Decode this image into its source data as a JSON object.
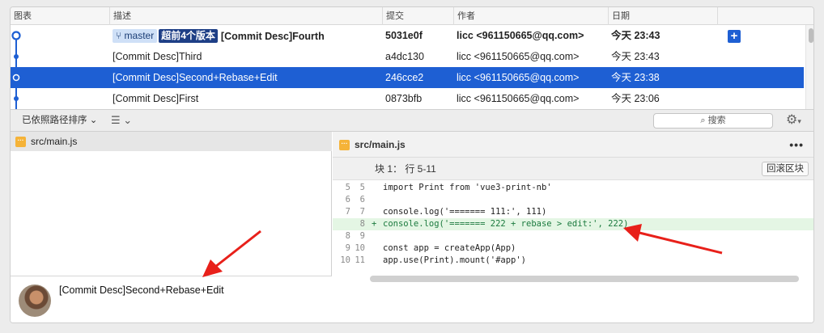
{
  "header": {
    "columns": [
      "图表",
      "描述",
      "提交",
      "作者",
      "日期"
    ]
  },
  "commits": [
    {
      "branch": "master",
      "ahead": "超前4个版本",
      "message": "[Commit Desc]Fourth",
      "hash": "5031e0f",
      "author": "licc <961150665@qq.com>",
      "date": "今天 23:43",
      "action": "+"
    },
    {
      "message": "[Commit Desc]Third",
      "hash": "a4dc130",
      "author": "licc <961150665@qq.com>",
      "date": "今天 23:43"
    },
    {
      "message": "[Commit Desc]Second+Rebase+Edit",
      "hash": "246cce2",
      "author": "licc <961150665@qq.com>",
      "date": "今天 23:38"
    },
    {
      "message": "[Commit Desc]First",
      "hash": "0873bfb",
      "author": "licc <961150665@qq.com>",
      "date": "今天 23:06"
    }
  ],
  "toolbar": {
    "sort_label": "已依照路径排序 ⌄",
    "list_label": "☰ ⌄",
    "search_placeholder": "搜索",
    "search_icon": "magnifier-icon",
    "settings_icon": "gear-icon"
  },
  "files": {
    "icon_text": "···",
    "selected": "src/main.js"
  },
  "commit_detail": {
    "message": "[Commit Desc]Second+Rebase+Edit"
  },
  "diff": {
    "filename": "src/main.js",
    "more_label": "•••",
    "hunk_title": "块 1： 行 5-11",
    "discard_label": "回滚区块",
    "lines": [
      {
        "old": "5",
        "new": "5",
        "sign": "",
        "code": "import Print from 'vue3-print-nb'",
        "type": "context"
      },
      {
        "old": "6",
        "new": "6",
        "sign": "",
        "code": "",
        "type": "context"
      },
      {
        "old": "7",
        "new": "7",
        "sign": "",
        "code": "console.log('======= 111:', 111)",
        "type": "context"
      },
      {
        "old": "",
        "new": "8",
        "sign": "+",
        "code": "console.log('======= 222 + rebase > edit:', 222)",
        "type": "add"
      },
      {
        "old": "8",
        "new": "9",
        "sign": "",
        "code": "",
        "type": "context"
      },
      {
        "old": "9",
        "new": "10",
        "sign": "",
        "code": "const app = createApp(App)",
        "type": "context"
      },
      {
        "old": "10",
        "new": "11",
        "sign": "",
        "code": "app.use(Print).mount('#app')",
        "type": "context"
      }
    ]
  },
  "colors": {
    "selection": "#1e5fd3",
    "added_bg": "#e4f6e4",
    "annotation_arrow": "#e8201a"
  }
}
